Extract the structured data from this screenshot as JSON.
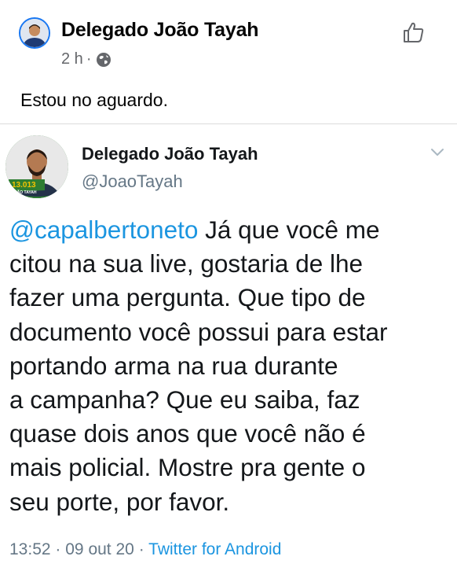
{
  "facebook_post": {
    "author": "Delegado João Tayah",
    "time": "2 h",
    "separator": "·",
    "text": "Estou no aguardo.",
    "icons": {
      "avatar": "profile-photo",
      "audience": "globe-icon",
      "like": "thumbs-up-icon"
    }
  },
  "tweet": {
    "author_name": "Delegado João Tayah",
    "handle": "@JoaoTayah",
    "avatar_badge": {
      "number": "13.013",
      "name": "JOÃO TAYAH"
    },
    "mention": "@capalbertoneto",
    "body_lines": [
      " Já que você me",
      "citou na sua live, gostaria de lhe",
      "fazer uma pergunta. Que tipo de",
      "documento você possui para estar",
      "portando arma na rua durante",
      "a campanha? Que eu saiba, faz",
      "quase dois anos que você não é",
      "mais policial. Mostre pra gente o",
      "seu porte, por favor."
    ],
    "time": "13:52",
    "date": "09 out 20",
    "separator": "·",
    "source": "Twitter for Android",
    "colors": {
      "link": "#1b95e0",
      "meta": "#657786",
      "text": "#14171a"
    }
  }
}
